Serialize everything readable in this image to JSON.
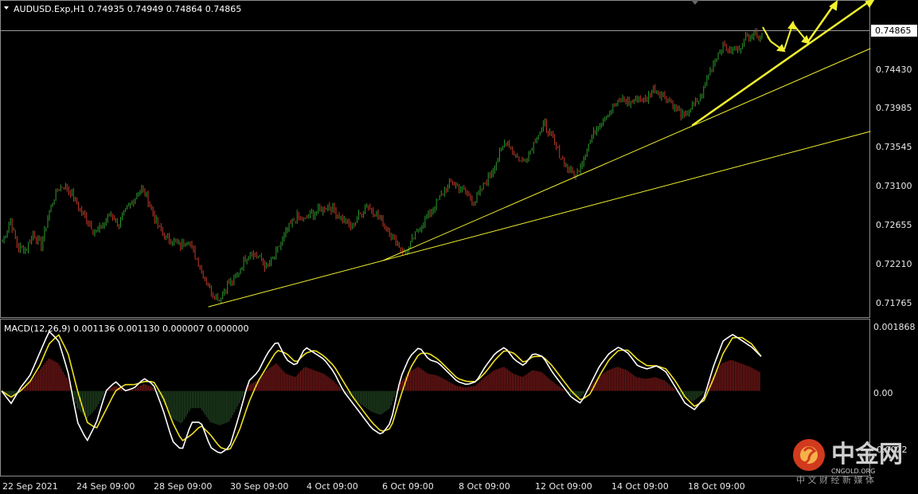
{
  "header": {
    "symbol_line": "AUDUSD.Exp,H1  0.74935 0.74949 0.74864 0.74865"
  },
  "price_axis": {
    "current_price_label": "0.74865",
    "ticks": [
      "0.74430",
      "0.73985",
      "0.73545",
      "0.73100",
      "0.72655",
      "0.72210",
      "0.71765"
    ]
  },
  "macd_panel": {
    "title": "MACD(12,26,9) 0.001136 0.001130 0.000007 0.000000",
    "ticks": [
      "0.001868",
      "0.00",
      "-0.0022"
    ]
  },
  "time_axis": {
    "ticks": [
      "22 Sep 2021",
      "24 Sep 09:00",
      "28 Sep 09:00",
      "30 Sep 09:00",
      "4 Oct 09:00",
      "6 Oct 09:00",
      "8 Oct 09:00",
      "12 Oct 09:00",
      "14 Oct 09:00",
      "18 Oct 09:00"
    ]
  },
  "watermark": {
    "brand": "中金网",
    "domain": "CNGOLD.ORG",
    "subtitle": "中 文 财 经 新 媒 体"
  },
  "colors": {
    "background": "#000000",
    "bull_candle": "#2e9a2e",
    "bear_candle": "#c43a2a",
    "trendline": "#ffff33",
    "macd_line": "#ffffff",
    "signal_line": "#f0e020",
    "histogram_pos": "#a02020",
    "histogram_neg": "#2c5a2c",
    "grid_line": "#bbbbbb",
    "watermark_red": "#d23a1e"
  },
  "chart_data": [
    {
      "type": "candlestick",
      "title": "AUDUSD.Exp,H1",
      "ohlc_last": {
        "open": 0.74935,
        "high": 0.74949,
        "low": 0.74864,
        "close": 0.74865
      },
      "ylim": [
        0.7162,
        0.7512
      ],
      "x": [
        "22 Sep 2021",
        "24 Sep 09:00",
        "28 Sep 09:00",
        "30 Sep 09:00",
        "4 Oct 09:00",
        "6 Oct 09:00",
        "8 Oct 09:00",
        "12 Oct 09:00",
        "14 Oct 09:00",
        "18 Oct 09:00"
      ],
      "close_path_approx": [
        0.7245,
        0.727,
        0.7238,
        0.7235,
        0.7255,
        0.724,
        0.7278,
        0.7305,
        0.7312,
        0.73,
        0.7283,
        0.727,
        0.7255,
        0.7265,
        0.7278,
        0.7265,
        0.7282,
        0.7295,
        0.7308,
        0.729,
        0.7265,
        0.725,
        0.7245,
        0.724,
        0.7248,
        0.7225,
        0.7205,
        0.7185,
        0.7178,
        0.7195,
        0.72,
        0.722,
        0.7233,
        0.7228,
        0.7215,
        0.7225,
        0.7245,
        0.7262,
        0.7275,
        0.727,
        0.7278,
        0.7282,
        0.7288,
        0.728,
        0.727,
        0.7262,
        0.7275,
        0.7288,
        0.728,
        0.7268,
        0.7255,
        0.7242,
        0.723,
        0.7248,
        0.7265,
        0.7275,
        0.729,
        0.7305,
        0.7315,
        0.7308,
        0.73,
        0.7292,
        0.731,
        0.7325,
        0.7345,
        0.7365,
        0.735,
        0.7338,
        0.735,
        0.737,
        0.7382,
        0.7365,
        0.7345,
        0.733,
        0.7322,
        0.7345,
        0.7368,
        0.7382,
        0.7395,
        0.7405,
        0.7412,
        0.7408,
        0.7415,
        0.741,
        0.7425,
        0.7418,
        0.7412,
        0.74,
        0.739,
        0.7405,
        0.7412,
        0.744,
        0.746,
        0.7475,
        0.7468,
        0.7472,
        0.7485,
        0.749,
        0.7486
      ]
    },
    {
      "type": "line",
      "title": "MACD(12,26,9)",
      "values_last": [
        0.001136,
        0.00113,
        7e-06,
        0.0
      ],
      "ylim": [
        -0.0024,
        0.0021
      ],
      "series": [
        {
          "values": [
            0.0,
            -0.0004,
            0.0001,
            0.0005,
            0.0012,
            0.0019,
            0.0016,
            0.0006,
            -0.001,
            -0.0016,
            -0.001,
            0.0,
            0.0003,
            0.0,
            0.0001,
            0.0004,
            0.0002,
            -0.0006,
            -0.0016,
            -0.0019,
            -0.001,
            -0.001,
            -0.0018,
            -0.002,
            -0.0018,
            -0.0008,
            0.0003,
            0.0006,
            0.0012,
            0.0016,
            0.001,
            0.0008,
            0.0014,
            0.0012,
            0.001,
            0.0006,
            0.0,
            -0.0004,
            -0.0008,
            -0.0012,
            -0.0014,
            -0.001,
            0.0004,
            0.0011,
            0.0014,
            0.001,
            0.0009,
            0.0006,
            0.0003,
            0.0002,
            0.0003,
            0.0008,
            0.0012,
            0.0014,
            0.001,
            0.0008,
            0.0012,
            0.0011,
            0.0006,
            0.0002,
            -0.0002,
            -0.0004,
            0.0002,
            0.0008,
            0.0012,
            0.0014,
            0.0012,
            0.0008,
            0.0007,
            0.0008,
            0.0006,
            0.0001,
            -0.0004,
            -0.0006,
            -0.0002,
            0.0008,
            0.0016,
            0.0018,
            0.0016,
            0.0014,
            0.0011
          ]
        },
        {
          "values": [
            0.0,
            -0.0002,
            0.0,
            0.0003,
            0.0008,
            0.0015,
            0.0018,
            0.0012,
            0.0,
            -0.001,
            -0.0012,
            -0.0006,
            0.0,
            0.0002,
            0.0002,
            0.0003,
            0.0003,
            -0.0002,
            -0.001,
            -0.0016,
            -0.0014,
            -0.0011,
            -0.0014,
            -0.0018,
            -0.0019,
            -0.0013,
            -0.0004,
            0.0003,
            0.0008,
            0.0013,
            0.0012,
            0.0009,
            0.0012,
            0.0013,
            0.0011,
            0.0008,
            0.0003,
            -0.0002,
            -0.0006,
            -0.001,
            -0.0013,
            -0.0012,
            -0.0002,
            0.0007,
            0.0012,
            0.0012,
            0.001,
            0.0007,
            0.0004,
            0.0003,
            0.0003,
            0.0006,
            0.001,
            0.0013,
            0.0012,
            0.0009,
            0.0011,
            0.0011,
            0.0008,
            0.0004,
            0.0,
            -0.0003,
            -0.0001,
            0.0005,
            0.001,
            0.0013,
            0.0013,
            0.001,
            0.0008,
            0.0008,
            0.0007,
            0.0003,
            -0.0002,
            -0.0005,
            -0.0003,
            0.0004,
            0.0012,
            0.0017,
            0.0017,
            0.0015,
            0.0011
          ]
        }
      ]
    }
  ]
}
